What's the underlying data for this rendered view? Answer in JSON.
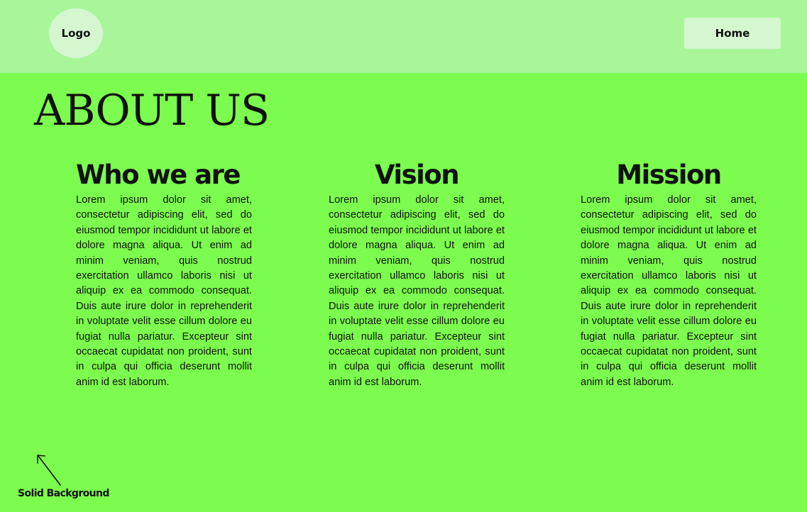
{
  "header": {
    "logo_label": "Logo",
    "home_label": "Home"
  },
  "main": {
    "title": "ABOUT US",
    "columns": [
      {
        "heading": "Who we are",
        "body": "Lorem ipsum dolor sit amet, consectetur adipiscing elit, sed do eiusmod tempor incididunt ut labore et dolore magna aliqua. Ut enim ad minim veniam, quis nostrud exercitation ullamco laboris nisi ut aliquip ex ea commodo consequat. Duis aute irure dolor in reprehenderit in voluptate velit esse cillum dolore eu fugiat nulla pariatur. Excepteur sint occaecat cupidatat non proident, sunt in culpa qui officia deserunt mollit anim id est laborum."
      },
      {
        "heading": "Vision",
        "body": "Lorem ipsum dolor sit amet, consectetur adipiscing elit, sed do eiusmod tempor incididunt ut labore et dolore magna aliqua. Ut enim ad minim veniam, quis nostrud exercitation ullamco laboris nisi ut aliquip ex ea commodo consequat. Duis aute irure dolor in reprehenderit in voluptate velit esse cillum dolore eu fugiat nulla pariatur. Excepteur sint occaecat cupidatat non proident, sunt in culpa qui officia deserunt mollit anim id est laborum."
      },
      {
        "heading": "Mission",
        "body": "Lorem ipsum dolor sit amet, consectetur adipiscing elit, sed do eiusmod tempor incididunt ut labore et dolore magna aliqua. Ut enim ad minim veniam, quis nostrud exercitation ullamco laboris nisi ut aliquip ex ea commodo consequat. Duis aute irure dolor in reprehenderit in voluptate velit esse cillum dolore eu fugiat nulla pariatur. Excepteur sint occaecat cupidatat non proident, sunt in culpa qui officia deserunt mollit anim id est laborum."
      }
    ]
  },
  "annotation": {
    "label": "Solid Background",
    "icon": "arrow-up-left-icon"
  },
  "colors": {
    "background": "#7cfc4e",
    "header": "#a8f59a",
    "button": "#d5f7d0",
    "text": "#111111"
  }
}
